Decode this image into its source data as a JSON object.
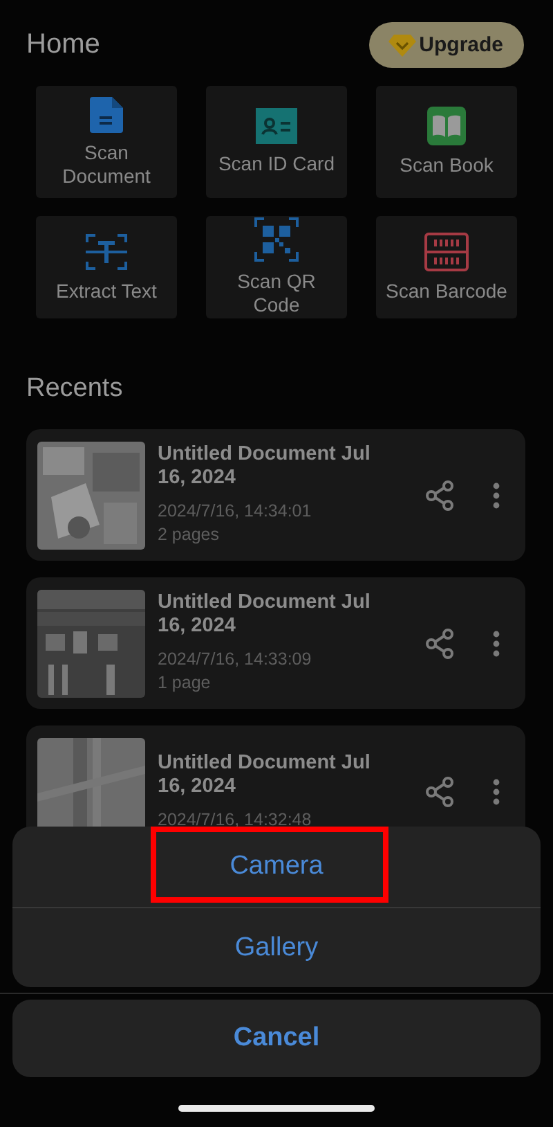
{
  "header": {
    "title": "Home",
    "upgrade_button": "Upgrade"
  },
  "tools": [
    {
      "label": "Scan Document",
      "kind": "document"
    },
    {
      "label": "Scan ID Card",
      "kind": "id_card"
    },
    {
      "label": "Scan Book",
      "kind": "book"
    },
    {
      "label": "Extract Text",
      "kind": "text"
    },
    {
      "label": "Scan QR Code",
      "kind": "qr"
    },
    {
      "label": "Scan Barcode",
      "kind": "barcode"
    }
  ],
  "recents": {
    "title": "Recents",
    "items": [
      {
        "title": "Untitled Document Jul 16, 2024",
        "date": "2024/7/16, 14:34:01",
        "pages": "2 pages"
      },
      {
        "title": "Untitled Document Jul 16, 2024",
        "date": "2024/7/16, 14:33:09",
        "pages": "1 page"
      },
      {
        "title": "Untitled Document Jul 16, 2024",
        "date": "2024/7/16, 14:32:48"
      }
    ]
  },
  "action_sheet": {
    "actions": [
      {
        "label": "Camera",
        "highlighted": true
      },
      {
        "label": "Gallery",
        "highlighted": false
      }
    ],
    "cancel": "Cancel"
  }
}
